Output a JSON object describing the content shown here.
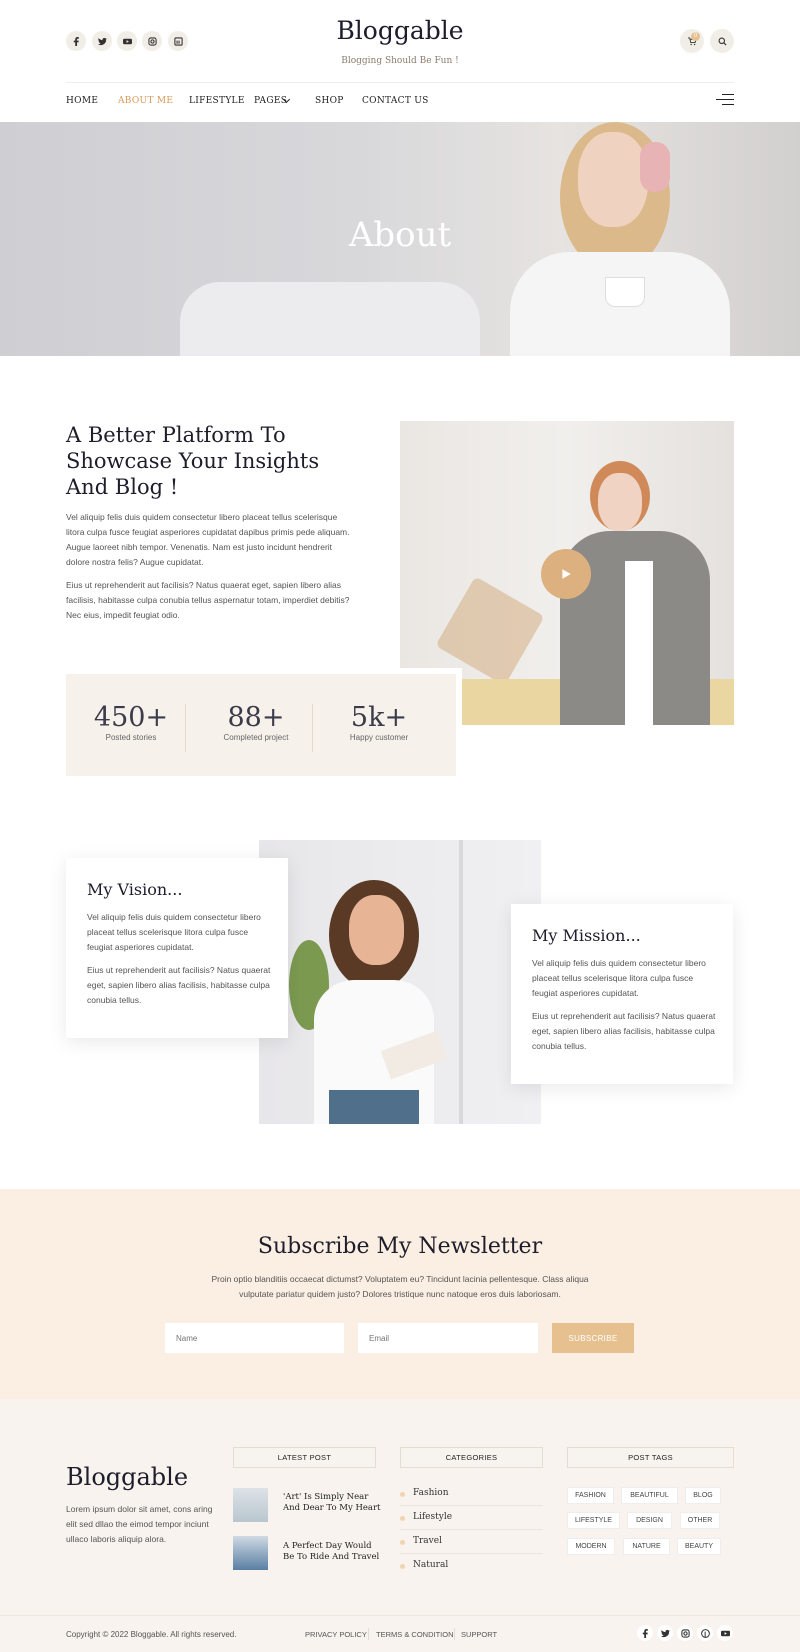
{
  "header": {
    "logo": "Bloggable",
    "tagline": "Blogging Should Be Fun !",
    "cart_count": "0",
    "social_icons": [
      "facebook-icon",
      "twitter-icon",
      "youtube-icon",
      "instagram-icon",
      "linkedin-icon"
    ]
  },
  "nav": {
    "items": [
      "HOME",
      "ABOUT ME",
      "LIFESTYLE",
      "PAGES",
      "SHOP",
      "CONTACT US"
    ],
    "active": "ABOUT ME"
  },
  "hero": {
    "title": "About"
  },
  "intro": {
    "heading": "A Better Platform To Showcase Your Insights And Blog !",
    "p1": "Vel aliquip felis duis quidem consectetur libero placeat tellus scelerisque litora culpa fusce feugiat asperiores cupidatat dapibus primis pede aliquam. Augue laoreet nibh tempor. Venenatis. Nam est justo incidunt hendrerit dolore nostra felis? Augue cupidatat.",
    "p2": "Eius ut reprehenderit aut facilisis? Natus quaerat eget, sapien libero alias facilisis, habitasse culpa conubia tellus aspernatur totam, imperdiet debitis? Nec eius, impedit feugiat odio."
  },
  "stats": [
    {
      "num": "450+",
      "label": "Posted stories"
    },
    {
      "num": "88+",
      "label": "Completed project"
    },
    {
      "num": "5k+",
      "label": "Happy customer"
    }
  ],
  "vision": {
    "title": "My Vision...",
    "p1": "Vel aliquip felis duis quidem consectetur libero placeat tellus scelerisque litora culpa fusce feugiat asperiores cupidatat.",
    "p2": "Eius ut reprehenderit aut facilisis? Natus quaerat eget, sapien libero alias facilisis, habitasse culpa conubia tellus."
  },
  "mission": {
    "title": "My Mission...",
    "p1": "Vel aliquip felis duis quidem consectetur libero placeat tellus scelerisque litora culpa fusce feugiat asperiores cupidatat.",
    "p2": "Eius ut reprehenderit aut facilisis? Natus quaerat eget, sapien libero alias facilisis, habitasse culpa conubia tellus."
  },
  "newsletter": {
    "title": "Subscribe My Newsletter",
    "text": "Proin optio blanditiis occaecat dictumst? Voluptatem eu? Tincidunt lacinia pellentesque. Class aliqua vulputate pariatur quidem justo? Dolores tristique nunc natoque eros duis laboriosam.",
    "name_placeholder": "Name",
    "email_placeholder": "Email",
    "button": "SUBSCRIBE"
  },
  "footer": {
    "logo": "Bloggable",
    "about": "Lorem ipsum dolor sit amet, cons aring elit sed dllao the eimod tempor inciunt ullaco laboris aliquip alora.",
    "latest_title": "LATEST POST",
    "posts": [
      "'Art' Is Simply Near And Dear To My Heart",
      "A Perfect Day Would Be To Ride And Travel"
    ],
    "categories_title": "CATEGORIES",
    "categories": [
      "Fashion",
      "Lifestyle",
      "Travel",
      "Natural"
    ],
    "tags_title": "POST TAGS",
    "tags": [
      "FASHION",
      "BEAUTIFUL",
      "BLOG",
      "LIFESTYLE",
      "DESIGN",
      "OTHER",
      "MODERN",
      "NATURE",
      "BEAUTY"
    ],
    "copyright": "Copyright © 2022 Bloggable. All rights reserved.",
    "links": [
      "PRIVACY POLICY",
      "TERMS & CONDITION",
      "SUPPORT"
    ],
    "social_icons": [
      "facebook-icon",
      "twitter-icon",
      "instagram-icon",
      "pinterest-icon",
      "youtube-icon"
    ]
  },
  "colors": {
    "accent": "#e6c08f",
    "nav_active": "#d79a5a",
    "cream": "#f8f3ee",
    "newsletter_bg": "#fbeee2"
  }
}
